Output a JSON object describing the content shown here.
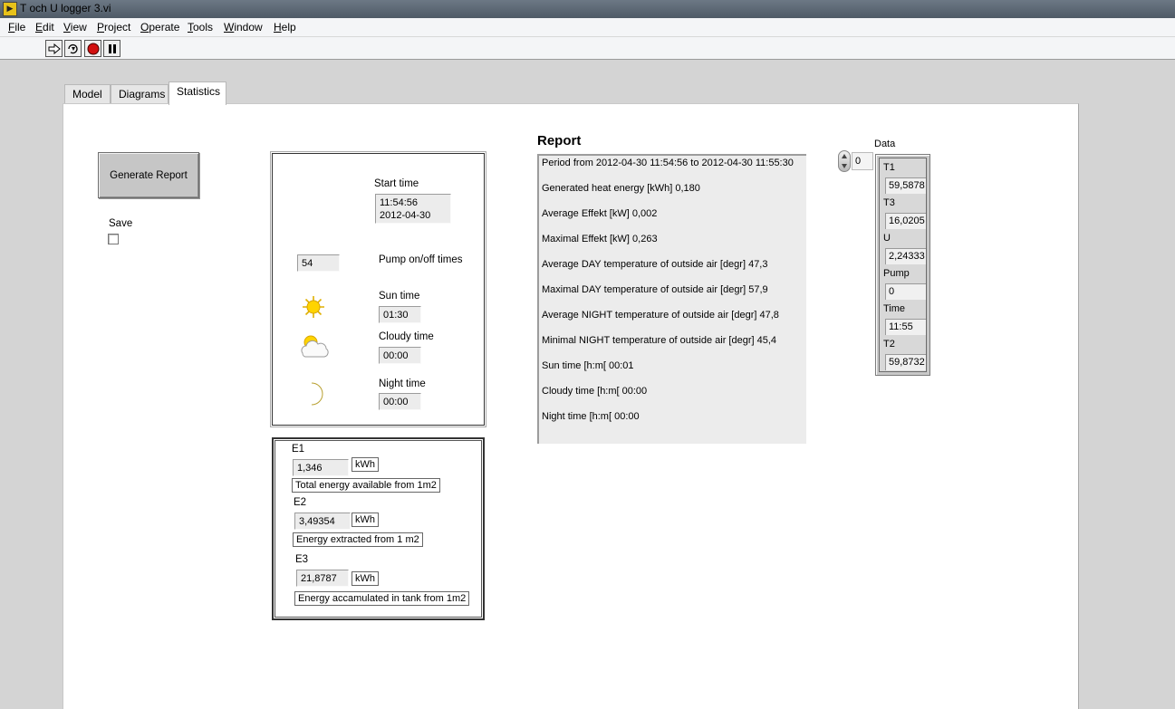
{
  "window": {
    "title": "T och U logger 3.vi",
    "app_icon_text": "▶"
  },
  "menu": [
    "File",
    "Edit",
    "View",
    "Project",
    "Operate",
    "Tools",
    "Window",
    "Help"
  ],
  "menu_underline": [
    "F",
    "E",
    "V",
    "P",
    "O",
    "T",
    "W",
    "H"
  ],
  "toolbar": {
    "buttons": [
      "run-icon",
      "run-continuously-icon",
      "abort-icon",
      "pause-icon"
    ]
  },
  "tabs": [
    {
      "label": "Model",
      "active": false
    },
    {
      "label": "Diagrams",
      "active": false
    },
    {
      "label": "Statistics",
      "active": true
    }
  ],
  "controls": {
    "generate_report_label": "Generate Report",
    "save_label": "Save",
    "save_checked": false
  },
  "times_box": {
    "start_time_label": "Start time",
    "start_time_value": "11:54:56\n2012-04-30",
    "pump_value": "54",
    "pump_label": "Pump on/off times",
    "sun_label": "Sun time",
    "sun_value": "01:30",
    "cloudy_label": "Cloudy time",
    "cloudy_value": "00:00",
    "night_label": "Night time",
    "night_value": "00:00"
  },
  "energy_box": {
    "items": [
      {
        "name": "E1",
        "value": "1,346",
        "unit": "kWh",
        "description": "Total energy available from 1m2"
      },
      {
        "name": "E2",
        "value": "3,49354",
        "unit": "kWh",
        "description": "Energy extracted from 1 m2"
      },
      {
        "name": "E3",
        "value": "21,8787",
        "unit": "kWh",
        "description": "Energy accamulated in tank from 1m2"
      }
    ]
  },
  "report": {
    "title": "Report",
    "lines": [
      "Period from 2012-04-30 11:54:56 to 2012-04-30 11:55:30",
      "Generated heat energy [kWh] 0,180",
      "Average Effekt [kW]  0,002",
      "Maximal Effekt [kW]  0,263",
      "Average DAY temperature of outside air [degr]  47,3",
      "Maximal DAY temperature of outside air [degr]  57,9",
      "Average NIGHT temperature of outside air [degr]  47,8",
      "Minimal  NIGHT temperature of outside air [degr]  45,4",
      "Sun time [h:m[  00:01",
      "Cloudy time [h:m[  00:00",
      "Night time [h:m[  00:00"
    ]
  },
  "data_cluster": {
    "title": "Data",
    "index_value": "0",
    "fields": [
      {
        "label": "T1",
        "value": "59,5878"
      },
      {
        "label": "T3",
        "value": "16,0205"
      },
      {
        "label": "U",
        "value": "2,24333"
      },
      {
        "label": "Pump",
        "value": "0"
      },
      {
        "label": "Time",
        "value": "11:55"
      },
      {
        "label": "T2",
        "value": "59,8732"
      }
    ]
  }
}
